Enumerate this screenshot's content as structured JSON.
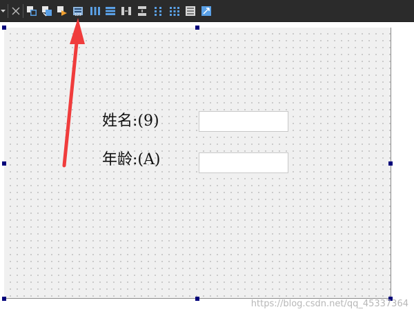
{
  "toolbar": {
    "buttons": [
      {
        "name": "dropdown-arrow-icon"
      },
      {
        "name": "close-icon"
      },
      {
        "name": "edit-widgets-icon"
      },
      {
        "name": "edit-signals-slots-icon"
      },
      {
        "name": "edit-buddies-icon"
      },
      {
        "name": "edit-tab-order-icon"
      },
      {
        "name": "layout-horizontally-icon"
      },
      {
        "name": "layout-vertically-icon"
      },
      {
        "name": "layout-horizontal-splitter-icon"
      },
      {
        "name": "layout-vertical-splitter-icon"
      },
      {
        "name": "layout-form-icon"
      },
      {
        "name": "layout-grid-icon"
      },
      {
        "name": "break-layout-icon"
      },
      {
        "name": "adjust-size-icon"
      }
    ],
    "colors": {
      "background": "#2b2b2b",
      "icon_blue": "#5aa0e6",
      "icon_orange": "#f0a030"
    }
  },
  "form": {
    "name_label": "姓名:(9)",
    "age_label": "年龄:(A)",
    "name_value": "",
    "age_value": ""
  },
  "annotation": {
    "arrow_color": "#f03c3c"
  },
  "watermark": "https://blog.csdn.net/qq_45337364"
}
